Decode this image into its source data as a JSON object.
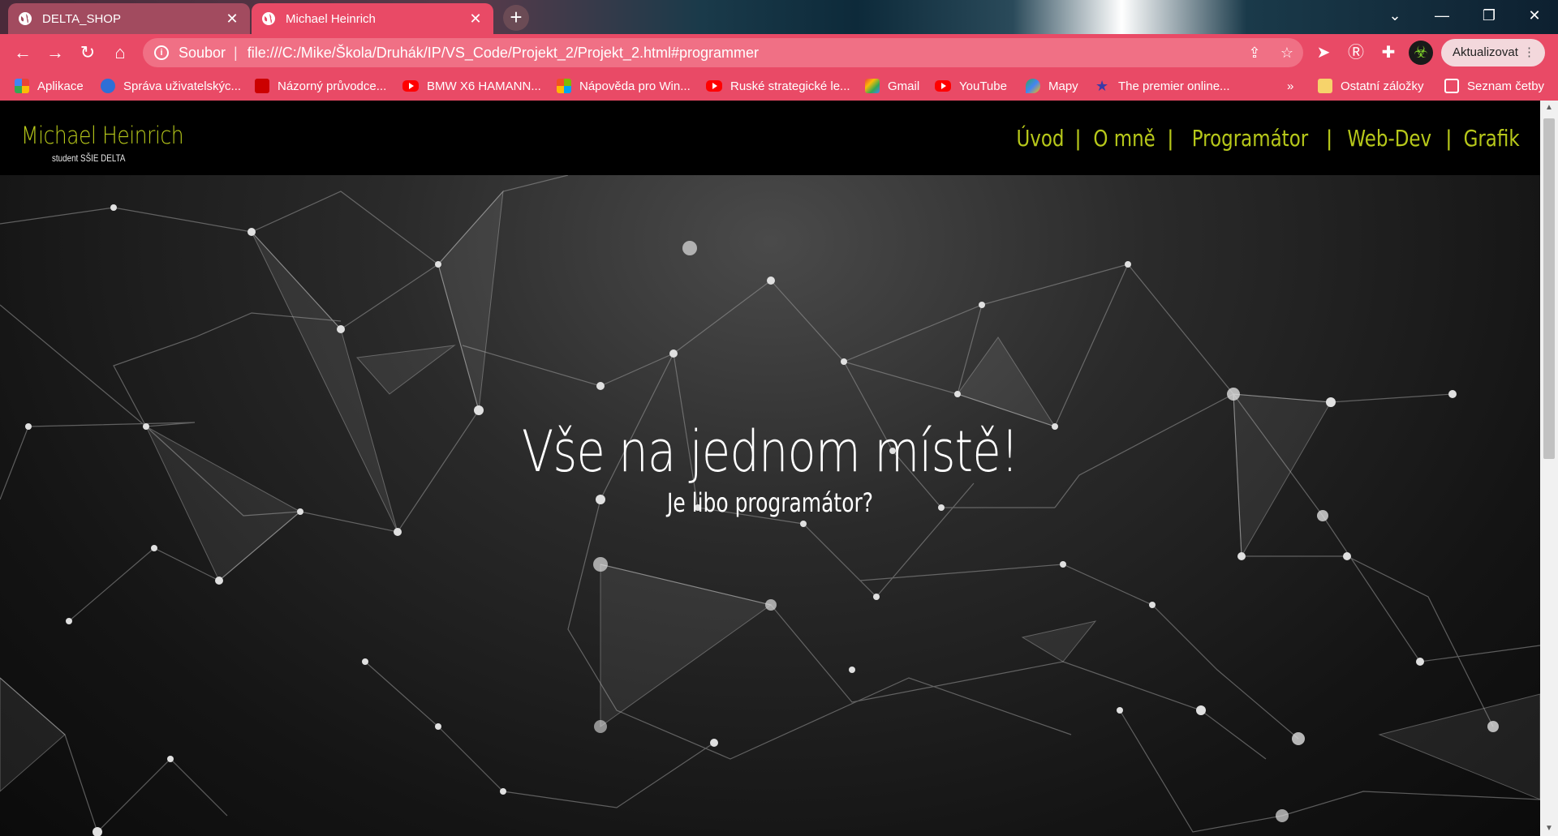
{
  "browser": {
    "tabs": [
      {
        "title": "DELTA_SHOP",
        "active": false
      },
      {
        "title": "Michael Heinrich",
        "active": true
      }
    ],
    "omnibox": {
      "scheme_label": "Soubor",
      "url": "file:///C:/Mike/Škola/Druhák/IP/VS_Code/Projekt_2/Projekt_2.html#programmer"
    },
    "update_label": "Aktualizovat",
    "bookmarks": [
      {
        "label": "Aplikace",
        "icon": "apps-grid-icon"
      },
      {
        "label": "Správa uživatelskýc...",
        "icon": "hp-icon"
      },
      {
        "label": "Názorný průvodce...",
        "icon": "zive-icon"
      },
      {
        "label": "BMW X6 HAMANN...",
        "icon": "youtube-icon"
      },
      {
        "label": "Nápověda pro Win...",
        "icon": "microsoft-icon"
      },
      {
        "label": "Ruské strategické le...",
        "icon": "youtube-icon"
      },
      {
        "label": "Gmail",
        "icon": "gmail-icon"
      },
      {
        "label": "YouTube",
        "icon": "youtube-icon"
      },
      {
        "label": "Mapy",
        "icon": "maps-icon"
      },
      {
        "label": "The premier online...",
        "icon": "star-icon"
      }
    ],
    "overflow_label": "»",
    "other_bookmarks": "Ostatní záložky",
    "reading_list": "Seznam četby",
    "colors": {
      "accent": "#e94a66",
      "tab_inactive": "#a24b5f"
    }
  },
  "site": {
    "brand": {
      "name": "Michael Heinrich",
      "subtitle": "student SŠIE DELTA"
    },
    "nav": [
      "Úvod",
      "O mně",
      "Programátor",
      "Web-Dev",
      "Grafik"
    ],
    "hero": {
      "title": "Vše na jednom místě!",
      "subtitle": "Je libo programátor?"
    },
    "colors": {
      "accent": "#b7c81a",
      "header_bg": "#000000"
    }
  }
}
